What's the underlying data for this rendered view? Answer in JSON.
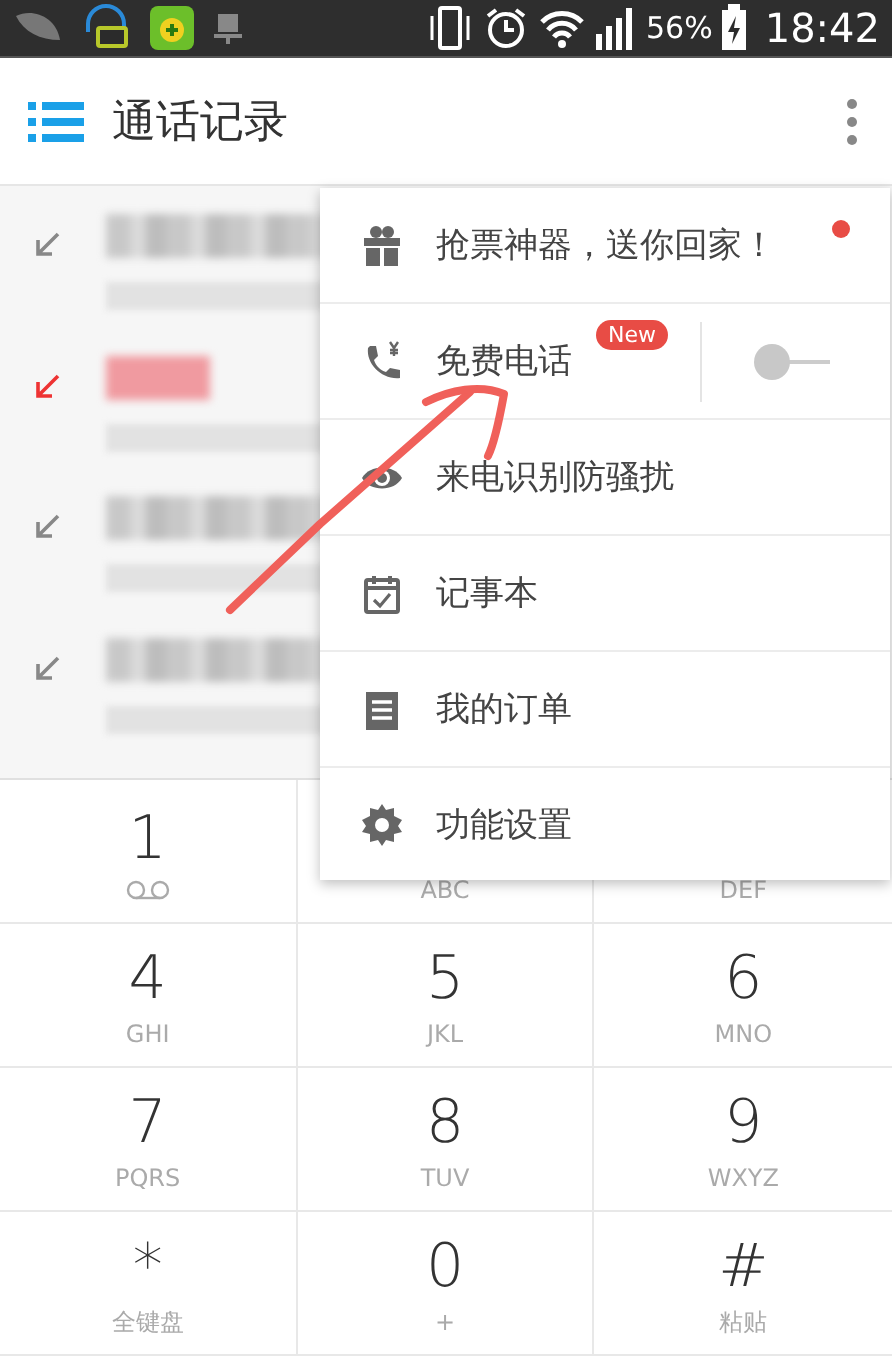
{
  "status_bar": {
    "battery": "56%",
    "time": "18:42"
  },
  "toolbar": {
    "title": "通话记录"
  },
  "call_log": [
    {
      "missed": false
    },
    {
      "missed": true
    },
    {
      "missed": false
    },
    {
      "missed": false
    }
  ],
  "menu": {
    "items": [
      {
        "kind": "gift",
        "label": "抢票神器，送你回家！",
        "dot": true
      },
      {
        "kind": "free-call",
        "label": "免费电话",
        "badge": "New",
        "toggle": {
          "on": false
        }
      },
      {
        "kind": "eye",
        "label": "来电识别防骚扰"
      },
      {
        "kind": "calendar",
        "label": "记事本"
      },
      {
        "kind": "orders",
        "label": "我的订单"
      },
      {
        "kind": "settings",
        "label": "功能设置"
      }
    ]
  },
  "keypad": [
    {
      "kind": "voicemail",
      "digit": "1"
    },
    {
      "kind": "letters",
      "letters": "ABC"
    },
    {
      "kind": "letters",
      "letters": "DEF"
    },
    {
      "kind": "letters",
      "digit": "4",
      "letters": "GHI"
    },
    {
      "kind": "letters",
      "digit": "5",
      "letters": "JKL"
    },
    {
      "kind": "letters",
      "digit": "6",
      "letters": "MNO"
    },
    {
      "kind": "letters",
      "digit": "7",
      "letters": "PQRS"
    },
    {
      "kind": "letters",
      "digit": "8",
      "letters": "TUV"
    },
    {
      "kind": "letters",
      "digit": "9",
      "letters": "WXYZ"
    },
    {
      "kind": "letters",
      "digit": "*",
      "letters": "全键盘"
    },
    {
      "kind": "letters",
      "digit": "0",
      "letters": "+"
    },
    {
      "kind": "letters",
      "digit": "#",
      "letters": "粘贴"
    }
  ]
}
